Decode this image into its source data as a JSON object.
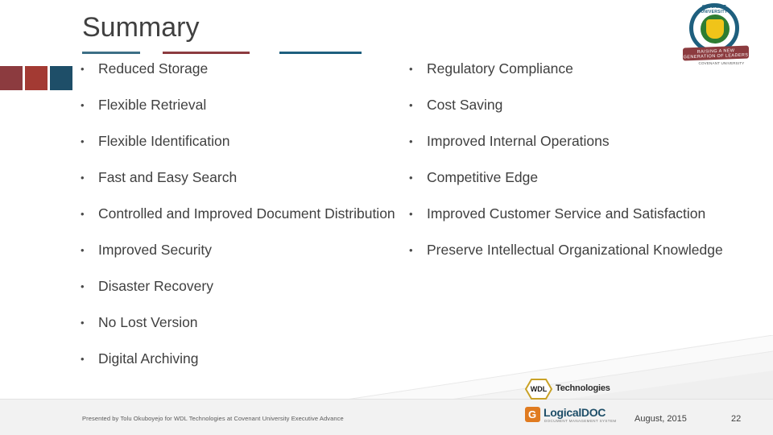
{
  "slide": {
    "title": "Summary",
    "left_column": [
      "Reduced Storage",
      "Flexible Retrieval",
      "Flexible Identification",
      "Fast and Easy Search",
      "Controlled and Improved Document Distribution",
      "Improved Security",
      "Disaster Recovery",
      "No Lost Version",
      "Digital Archiving"
    ],
    "right_column": [
      "Regulatory Compliance",
      "Cost Saving",
      "Improved Internal Operations",
      "Competitive Edge",
      "Improved Customer Service and Satisfaction",
      "Preserve Intellectual Organizational Knowledge"
    ],
    "bullet_glyph": "•"
  },
  "footer": {
    "note": "Presented by Tolu Okuboyejo for WDL Technologies at Covenant University Executive Advance",
    "date": "August, 2015",
    "page_number": "22"
  },
  "logos": {
    "wdl": {
      "mark_text": "WDL",
      "wordmark": "Technologies"
    },
    "logicaldoc": {
      "mark_letter": "G",
      "wordmark": "LogicalDOC",
      "tagline": "DOCUMENT MANAGEMENT SYSTEM"
    },
    "crest": {
      "top_text": "COVENANT UNIVERSITY",
      "ribbon_text": "RAISING A NEW GENERATION OF LEADERS",
      "sub_text": "COVENANT UNIVERSITY"
    }
  },
  "colors": {
    "accent_blue": "#1e5f7e",
    "accent_maroon": "#8c3b3f",
    "accent_red": "#a33a33",
    "text": "#3f3f3f",
    "band": "#f2f2f2",
    "orange": "#e07b20"
  }
}
